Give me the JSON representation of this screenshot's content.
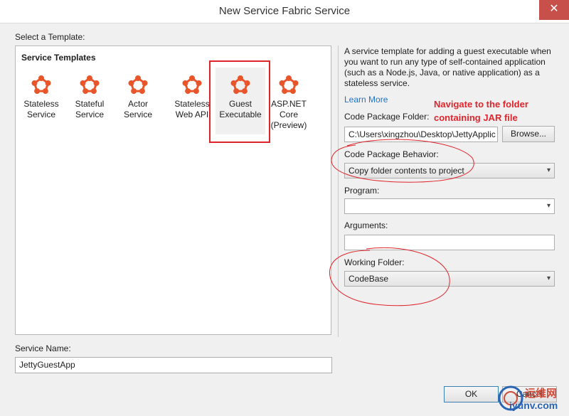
{
  "window": {
    "title": "New Service Fabric Service",
    "close_glyph": "✕"
  },
  "templates": {
    "select_label": "Select a Template:",
    "heading": "Service Templates",
    "items": [
      {
        "label": "Stateless\nService"
      },
      {
        "label": "Stateful\nService"
      },
      {
        "label": "Actor Service"
      },
      {
        "label": "Stateless\nWeb API"
      },
      {
        "label": "Guest\nExecutable",
        "selected": true
      },
      {
        "label": "ASP.NET\nCore\n(Preview)"
      }
    ],
    "icon": "service-fabric-icon",
    "icon_color": "#e8552b"
  },
  "details": {
    "description": "A service template for adding a guest executable when you want to run any type of self-contained application (such as a Node.js, Java, or native application) as a stateless service.",
    "learn_more": "Learn More",
    "code_package_folder_label": "Code Package Folder:",
    "code_package_folder_value": "C:\\Users\\xingzhou\\Desktop\\JettyApplic",
    "browse_label": "Browse...",
    "code_package_behavior_label": "Code Package Behavior:",
    "code_package_behavior_value": "Copy folder contents to project",
    "program_label": "Program:",
    "program_value": "",
    "arguments_label": "Arguments:",
    "arguments_value": "",
    "working_folder_label": "Working Folder:",
    "working_folder_value": "CodeBase"
  },
  "annotation": {
    "text": "Navigate to the folder\ncontaining JAR file",
    "color": "#e0242b"
  },
  "service_name": {
    "label": "Service Name:",
    "value": "JettyGuestApp"
  },
  "buttons": {
    "ok": "OK",
    "cancel": "Cancel"
  },
  "watermark": {
    "line1": "运维网",
    "line2": "iyunv.com"
  }
}
